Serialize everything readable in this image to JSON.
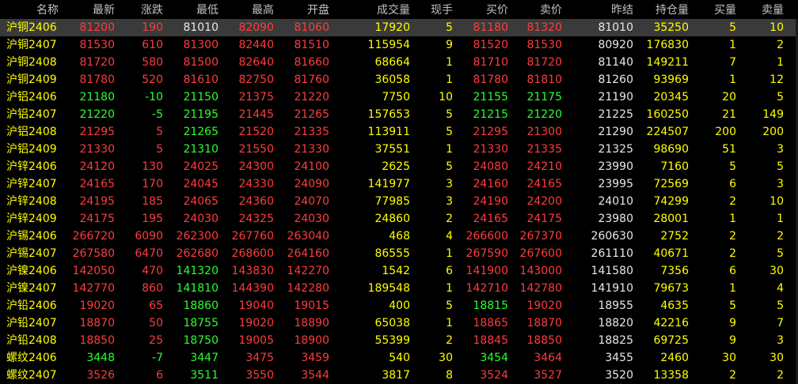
{
  "headers": [
    "名称",
    "最新",
    "涨跌",
    "最低",
    "最高",
    "开盘",
    "成交量",
    "现手",
    "买价",
    "卖价",
    "昨结",
    "持仓量",
    "买量",
    "卖量"
  ],
  "colors": {
    "up": "#ff3c3c",
    "down": "#2cff2c",
    "flat": "#e8e8e8",
    "name": "#ffff00",
    "header": "#c0c0c0",
    "background": "#000000",
    "selected_row": "#3a3a3a"
  },
  "selected_row": 0,
  "rows": [
    {
      "name": "沪铜2406",
      "last": "81200",
      "change": "190",
      "low": "81010",
      "high": "82090",
      "open": "81060",
      "volume": "17920",
      "cur_hand": "5",
      "bid": "81180",
      "ask": "81320",
      "prev_settle": "81010",
      "open_interest": "35250",
      "bid_vol": "5",
      "ask_vol": "10"
    },
    {
      "name": "沪铜2407",
      "last": "81530",
      "change": "610",
      "low": "81300",
      "high": "82440",
      "open": "81510",
      "volume": "115954",
      "cur_hand": "9",
      "bid": "81520",
      "ask": "81530",
      "prev_settle": "80920",
      "open_interest": "176830",
      "bid_vol": "1",
      "ask_vol": "2"
    },
    {
      "name": "沪铜2408",
      "last": "81720",
      "change": "580",
      "low": "81500",
      "high": "82640",
      "open": "81660",
      "volume": "68664",
      "cur_hand": "1",
      "bid": "81710",
      "ask": "81720",
      "prev_settle": "81140",
      "open_interest": "149211",
      "bid_vol": "7",
      "ask_vol": "1"
    },
    {
      "name": "沪铜2409",
      "last": "81780",
      "change": "520",
      "low": "81610",
      "high": "82750",
      "open": "81760",
      "volume": "36058",
      "cur_hand": "1",
      "bid": "81780",
      "ask": "81810",
      "prev_settle": "81260",
      "open_interest": "93969",
      "bid_vol": "1",
      "ask_vol": "12"
    },
    {
      "name": "沪铝2406",
      "last": "21180",
      "change": "-10",
      "low": "21150",
      "high": "21375",
      "open": "21220",
      "volume": "7750",
      "cur_hand": "10",
      "bid": "21155",
      "ask": "21175",
      "prev_settle": "21190",
      "open_interest": "20345",
      "bid_vol": "20",
      "ask_vol": "5"
    },
    {
      "name": "沪铝2407",
      "last": "21220",
      "change": "-5",
      "low": "21195",
      "high": "21445",
      "open": "21265",
      "volume": "157653",
      "cur_hand": "5",
      "bid": "21215",
      "ask": "21220",
      "prev_settle": "21225",
      "open_interest": "160250",
      "bid_vol": "21",
      "ask_vol": "149"
    },
    {
      "name": "沪铝2408",
      "last": "21295",
      "change": "5",
      "low": "21265",
      "high": "21520",
      "open": "21335",
      "volume": "113911",
      "cur_hand": "5",
      "bid": "21295",
      "ask": "21300",
      "prev_settle": "21290",
      "open_interest": "224507",
      "bid_vol": "200",
      "ask_vol": "200"
    },
    {
      "name": "沪铝2409",
      "last": "21330",
      "change": "5",
      "low": "21310",
      "high": "21550",
      "open": "21330",
      "volume": "37551",
      "cur_hand": "1",
      "bid": "21330",
      "ask": "21335",
      "prev_settle": "21325",
      "open_interest": "98690",
      "bid_vol": "51",
      "ask_vol": "3"
    },
    {
      "name": "沪锌2406",
      "last": "24120",
      "change": "130",
      "low": "24025",
      "high": "24300",
      "open": "24100",
      "volume": "2625",
      "cur_hand": "5",
      "bid": "24080",
      "ask": "24210",
      "prev_settle": "23990",
      "open_interest": "7160",
      "bid_vol": "5",
      "ask_vol": "5"
    },
    {
      "name": "沪锌2407",
      "last": "24165",
      "change": "170",
      "low": "24045",
      "high": "24330",
      "open": "24090",
      "volume": "141977",
      "cur_hand": "3",
      "bid": "24160",
      "ask": "24165",
      "prev_settle": "23995",
      "open_interest": "72569",
      "bid_vol": "6",
      "ask_vol": "3"
    },
    {
      "name": "沪锌2408",
      "last": "24195",
      "change": "185",
      "low": "24065",
      "high": "24360",
      "open": "24070",
      "volume": "77985",
      "cur_hand": "3",
      "bid": "24190",
      "ask": "24200",
      "prev_settle": "24010",
      "open_interest": "74299",
      "bid_vol": "2",
      "ask_vol": "10"
    },
    {
      "name": "沪锌2409",
      "last": "24175",
      "change": "195",
      "low": "24030",
      "high": "24325",
      "open": "24030",
      "volume": "24860",
      "cur_hand": "2",
      "bid": "24165",
      "ask": "24175",
      "prev_settle": "23980",
      "open_interest": "28001",
      "bid_vol": "1",
      "ask_vol": "1"
    },
    {
      "name": "沪锡2406",
      "last": "266720",
      "change": "6090",
      "low": "262300",
      "high": "267760",
      "open": "263040",
      "volume": "468",
      "cur_hand": "4",
      "bid": "266600",
      "ask": "267370",
      "prev_settle": "260630",
      "open_interest": "2752",
      "bid_vol": "2",
      "ask_vol": "2"
    },
    {
      "name": "沪锡2407",
      "last": "267580",
      "change": "6470",
      "low": "262680",
      "high": "268600",
      "open": "264160",
      "volume": "86555",
      "cur_hand": "1",
      "bid": "267590",
      "ask": "267600",
      "prev_settle": "261110",
      "open_interest": "40671",
      "bid_vol": "2",
      "ask_vol": "5"
    },
    {
      "name": "沪镍2406",
      "last": "142050",
      "change": "470",
      "low": "141320",
      "high": "143830",
      "open": "142270",
      "volume": "1542",
      "cur_hand": "6",
      "bid": "141900",
      "ask": "143000",
      "prev_settle": "141580",
      "open_interest": "7356",
      "bid_vol": "6",
      "ask_vol": "30"
    },
    {
      "name": "沪镍2407",
      "last": "142770",
      "change": "860",
      "low": "141810",
      "high": "144390",
      "open": "142280",
      "volume": "189548",
      "cur_hand": "1",
      "bid": "142710",
      "ask": "142780",
      "prev_settle": "141910",
      "open_interest": "79673",
      "bid_vol": "1",
      "ask_vol": "4"
    },
    {
      "name": "沪铅2406",
      "last": "19020",
      "change": "65",
      "low": "18860",
      "high": "19040",
      "open": "19015",
      "volume": "400",
      "cur_hand": "5",
      "bid": "18815",
      "ask": "19020",
      "prev_settle": "18955",
      "open_interest": "4635",
      "bid_vol": "5",
      "ask_vol": "5"
    },
    {
      "name": "沪铅2407",
      "last": "18870",
      "change": "50",
      "low": "18755",
      "high": "19020",
      "open": "18890",
      "volume": "65038",
      "cur_hand": "1",
      "bid": "18865",
      "ask": "18870",
      "prev_settle": "18820",
      "open_interest": "42216",
      "bid_vol": "9",
      "ask_vol": "7"
    },
    {
      "name": "沪铅2408",
      "last": "18850",
      "change": "25",
      "low": "18750",
      "high": "19005",
      "open": "18900",
      "volume": "55399",
      "cur_hand": "2",
      "bid": "18845",
      "ask": "18850",
      "prev_settle": "18825",
      "open_interest": "69725",
      "bid_vol": "9",
      "ask_vol": "3"
    },
    {
      "name": "螺纹2406",
      "last": "3448",
      "change": "-7",
      "low": "3447",
      "high": "3475",
      "open": "3459",
      "volume": "540",
      "cur_hand": "30",
      "bid": "3454",
      "ask": "3464",
      "prev_settle": "3455",
      "open_interest": "2460",
      "bid_vol": "30",
      "ask_vol": "30"
    },
    {
      "name": "螺纹2407",
      "last": "3526",
      "change": "6",
      "low": "3511",
      "high": "3550",
      "open": "3544",
      "volume": "3817",
      "cur_hand": "8",
      "bid": "3524",
      "ask": "3527",
      "prev_settle": "3520",
      "open_interest": "13358",
      "bid_vol": "2",
      "ask_vol": "2"
    }
  ]
}
